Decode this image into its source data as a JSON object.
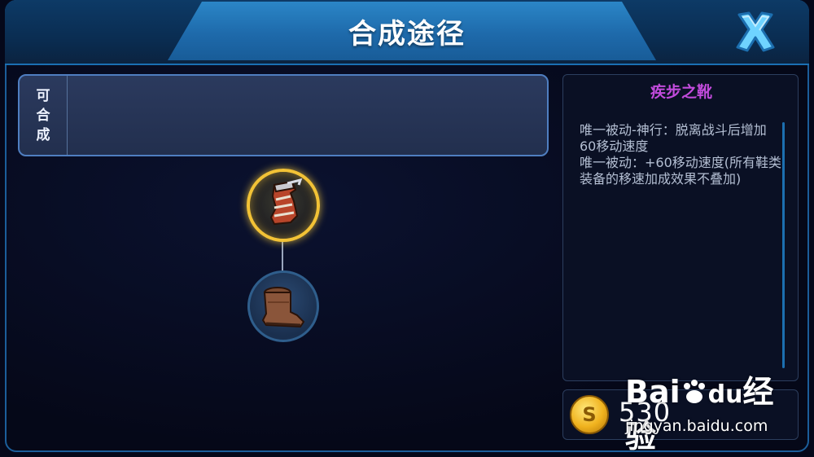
{
  "header": {
    "title": "合成途径"
  },
  "craft_panel": {
    "label_chars": [
      "可",
      "合",
      "成"
    ]
  },
  "item_info": {
    "name": "疾步之靴",
    "description_lines": [
      "唯一被动-神行：脱离战斗后增加60移动速度",
      "唯一被动：+60移动速度(所有鞋类装备的移速加成效果不叠加)"
    ]
  },
  "price": {
    "value": "530",
    "icon": "gold-coin-icon"
  },
  "watermark": {
    "logo": "Bai",
    "logo_du": "du",
    "logo_suffix": "经验",
    "url": "jingyan.baidu.com"
  },
  "colors": {
    "item_name": "#c24bdc",
    "accent_blue": "#1c6fb0",
    "gold": "#f2c236"
  }
}
